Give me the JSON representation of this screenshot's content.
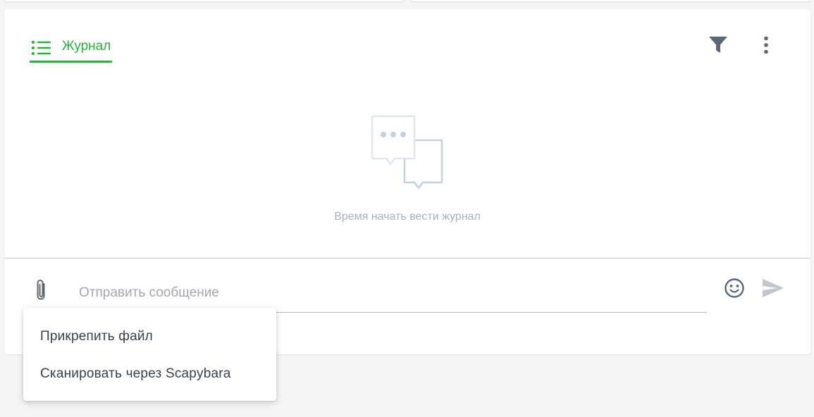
{
  "journal": {
    "tab_label": "Журнал",
    "empty_text": "Время начать вести журнал"
  },
  "composer": {
    "placeholder": "Отправить сообщение",
    "value": ""
  },
  "attach_menu": {
    "items": [
      {
        "label": "Прикрепить файл"
      },
      {
        "label": "Сканировать через Scapybara"
      }
    ]
  },
  "icons": {
    "tab": "list-icon",
    "filter": "filter-icon",
    "more": "more-vertical-icon",
    "empty": "chat-bubbles-icon",
    "attach": "paperclip-icon",
    "emoji": "smiley-icon",
    "send": "send-icon"
  },
  "colors": {
    "accent": "#2ab13e",
    "icon_dark": "#5f6673",
    "empty_icon": "#c7d1dd",
    "send_disabled": "#c3c7cd",
    "placeholder_text": "#a4a8ad"
  }
}
